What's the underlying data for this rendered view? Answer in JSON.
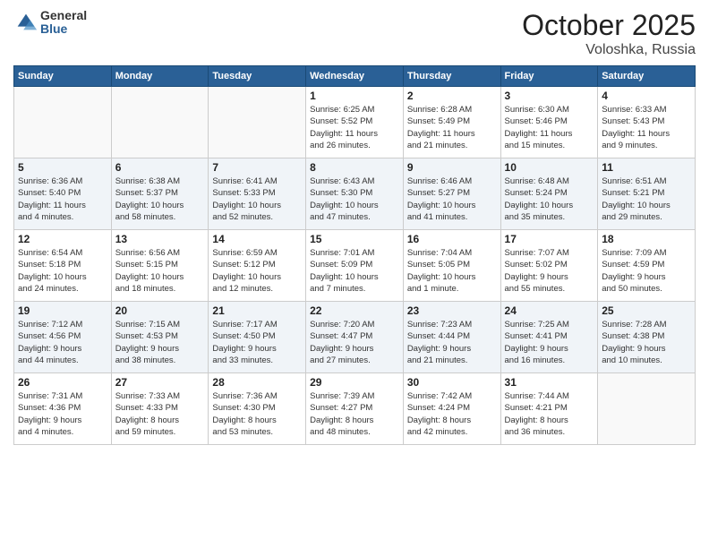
{
  "header": {
    "logo": {
      "general": "General",
      "blue": "Blue"
    },
    "title": "October 2025",
    "subtitle": "Voloshka, Russia"
  },
  "weekdays": [
    "Sunday",
    "Monday",
    "Tuesday",
    "Wednesday",
    "Thursday",
    "Friday",
    "Saturday"
  ],
  "weeks": [
    [
      {
        "day": "",
        "info": ""
      },
      {
        "day": "",
        "info": ""
      },
      {
        "day": "",
        "info": ""
      },
      {
        "day": "1",
        "info": "Sunrise: 6:25 AM\nSunset: 5:52 PM\nDaylight: 11 hours\nand 26 minutes."
      },
      {
        "day": "2",
        "info": "Sunrise: 6:28 AM\nSunset: 5:49 PM\nDaylight: 11 hours\nand 21 minutes."
      },
      {
        "day": "3",
        "info": "Sunrise: 6:30 AM\nSunset: 5:46 PM\nDaylight: 11 hours\nand 15 minutes."
      },
      {
        "day": "4",
        "info": "Sunrise: 6:33 AM\nSunset: 5:43 PM\nDaylight: 11 hours\nand 9 minutes."
      }
    ],
    [
      {
        "day": "5",
        "info": "Sunrise: 6:36 AM\nSunset: 5:40 PM\nDaylight: 11 hours\nand 4 minutes."
      },
      {
        "day": "6",
        "info": "Sunrise: 6:38 AM\nSunset: 5:37 PM\nDaylight: 10 hours\nand 58 minutes."
      },
      {
        "day": "7",
        "info": "Sunrise: 6:41 AM\nSunset: 5:33 PM\nDaylight: 10 hours\nand 52 minutes."
      },
      {
        "day": "8",
        "info": "Sunrise: 6:43 AM\nSunset: 5:30 PM\nDaylight: 10 hours\nand 47 minutes."
      },
      {
        "day": "9",
        "info": "Sunrise: 6:46 AM\nSunset: 5:27 PM\nDaylight: 10 hours\nand 41 minutes."
      },
      {
        "day": "10",
        "info": "Sunrise: 6:48 AM\nSunset: 5:24 PM\nDaylight: 10 hours\nand 35 minutes."
      },
      {
        "day": "11",
        "info": "Sunrise: 6:51 AM\nSunset: 5:21 PM\nDaylight: 10 hours\nand 29 minutes."
      }
    ],
    [
      {
        "day": "12",
        "info": "Sunrise: 6:54 AM\nSunset: 5:18 PM\nDaylight: 10 hours\nand 24 minutes."
      },
      {
        "day": "13",
        "info": "Sunrise: 6:56 AM\nSunset: 5:15 PM\nDaylight: 10 hours\nand 18 minutes."
      },
      {
        "day": "14",
        "info": "Sunrise: 6:59 AM\nSunset: 5:12 PM\nDaylight: 10 hours\nand 12 minutes."
      },
      {
        "day": "15",
        "info": "Sunrise: 7:01 AM\nSunset: 5:09 PM\nDaylight: 10 hours\nand 7 minutes."
      },
      {
        "day": "16",
        "info": "Sunrise: 7:04 AM\nSunset: 5:05 PM\nDaylight: 10 hours\nand 1 minute."
      },
      {
        "day": "17",
        "info": "Sunrise: 7:07 AM\nSunset: 5:02 PM\nDaylight: 9 hours\nand 55 minutes."
      },
      {
        "day": "18",
        "info": "Sunrise: 7:09 AM\nSunset: 4:59 PM\nDaylight: 9 hours\nand 50 minutes."
      }
    ],
    [
      {
        "day": "19",
        "info": "Sunrise: 7:12 AM\nSunset: 4:56 PM\nDaylight: 9 hours\nand 44 minutes."
      },
      {
        "day": "20",
        "info": "Sunrise: 7:15 AM\nSunset: 4:53 PM\nDaylight: 9 hours\nand 38 minutes."
      },
      {
        "day": "21",
        "info": "Sunrise: 7:17 AM\nSunset: 4:50 PM\nDaylight: 9 hours\nand 33 minutes."
      },
      {
        "day": "22",
        "info": "Sunrise: 7:20 AM\nSunset: 4:47 PM\nDaylight: 9 hours\nand 27 minutes."
      },
      {
        "day": "23",
        "info": "Sunrise: 7:23 AM\nSunset: 4:44 PM\nDaylight: 9 hours\nand 21 minutes."
      },
      {
        "day": "24",
        "info": "Sunrise: 7:25 AM\nSunset: 4:41 PM\nDaylight: 9 hours\nand 16 minutes."
      },
      {
        "day": "25",
        "info": "Sunrise: 7:28 AM\nSunset: 4:38 PM\nDaylight: 9 hours\nand 10 minutes."
      }
    ],
    [
      {
        "day": "26",
        "info": "Sunrise: 7:31 AM\nSunset: 4:36 PM\nDaylight: 9 hours\nand 4 minutes."
      },
      {
        "day": "27",
        "info": "Sunrise: 7:33 AM\nSunset: 4:33 PM\nDaylight: 8 hours\nand 59 minutes."
      },
      {
        "day": "28",
        "info": "Sunrise: 7:36 AM\nSunset: 4:30 PM\nDaylight: 8 hours\nand 53 minutes."
      },
      {
        "day": "29",
        "info": "Sunrise: 7:39 AM\nSunset: 4:27 PM\nDaylight: 8 hours\nand 48 minutes."
      },
      {
        "day": "30",
        "info": "Sunrise: 7:42 AM\nSunset: 4:24 PM\nDaylight: 8 hours\nand 42 minutes."
      },
      {
        "day": "31",
        "info": "Sunrise: 7:44 AM\nSunset: 4:21 PM\nDaylight: 8 hours\nand 36 minutes."
      },
      {
        "day": "",
        "info": ""
      }
    ]
  ]
}
